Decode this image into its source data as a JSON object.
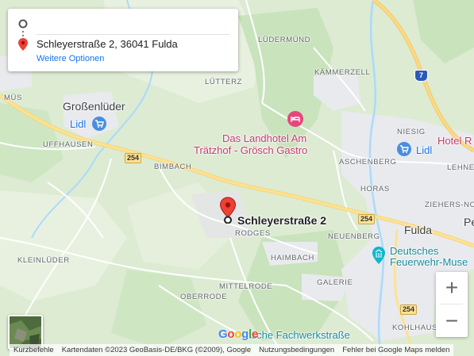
{
  "directions": {
    "address": "Schleyerstraße 2, 36041 Fulda",
    "more_options": "Weitere Optionen"
  },
  "pin_label": "Schleyerstraße 2",
  "places": {
    "luedermuend": "LÜDERMÜND",
    "kaemmerzell": "KÄMMERZELL",
    "mues": "MÜS",
    "luetterz": "LÜTTERZ",
    "grossenlueder": "Großenlüder",
    "uffhausen": "UFFHAUSEN",
    "niesig": "NIESIG",
    "aschenberg": "ASCHENBERG",
    "lehnerz": "LEHNER",
    "bimbach": "BIMBACH",
    "horas": "HORAS",
    "ziehers_nord": "ZIEHERS-NORD",
    "rodges": "RODGES",
    "neuenberg": "NEUENBERG",
    "fulda": "Fulda",
    "pe": "Pe",
    "kleinlueder": "KLEINLÜDER",
    "haimbach": "HAIMBACH",
    "mittelrode": "MITTELRODE",
    "oberrode": "OBERRODE",
    "galerie": "GALERIE",
    "kohlhaus": "KOHLHAUS"
  },
  "pois": {
    "lidl1": "Lidl",
    "lidl2": "Lidl",
    "hotel_line1": "Das Landhotel Am",
    "hotel_line2": "Trätzhof - Grösch Gastro",
    "hotel_r": "Hotel R",
    "museum_line1": "Deutsches",
    "museum_line2": "Feuerwehr-Muse",
    "fachwerk": "tsche Fachwerkstraße"
  },
  "roads": {
    "r254a": "254",
    "r254b": "254",
    "r254c": "254",
    "a7": "7"
  },
  "zoom": {
    "in": "+",
    "out": "−"
  },
  "footer": {
    "shortcuts": "Kurzbefehle",
    "mapdata": "Kartendaten ©2023 GeoBasis-DE/BKG (©2009), Google",
    "terms": "Nutzungsbedingungen",
    "report": "Fehler bei Google Maps melden"
  },
  "logo": "Google"
}
